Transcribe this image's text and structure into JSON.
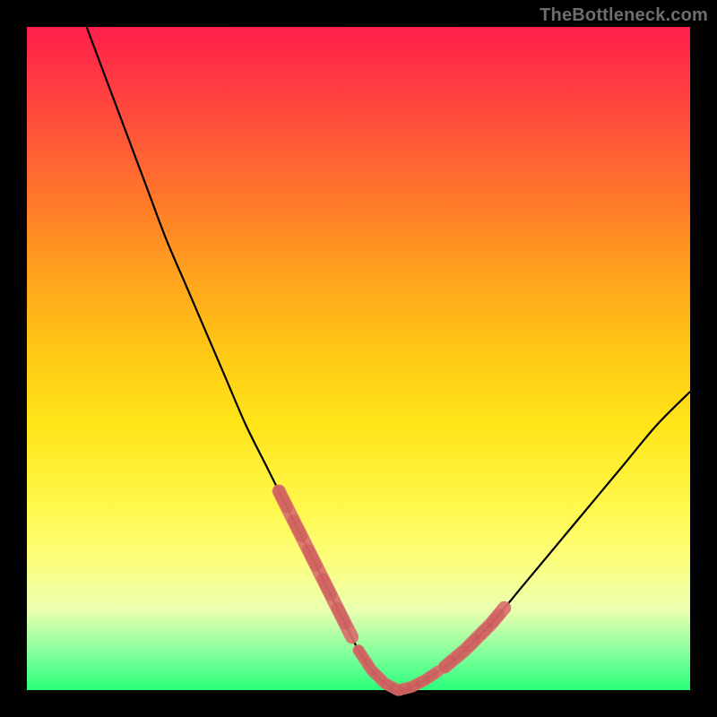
{
  "watermark": "TheBottleneck.com",
  "chart_data": {
    "type": "line",
    "title": "",
    "xlabel": "",
    "ylabel": "",
    "xlim": [
      0,
      100
    ],
    "ylim": [
      0,
      100
    ],
    "grid": false,
    "legend": false,
    "series": [
      {
        "name": "bottleneck-curve",
        "x": [
          9,
          12,
          15,
          18,
          21,
          24,
          27,
          30,
          33,
          36,
          38,
          40,
          42,
          44,
          46,
          48,
          50,
          52,
          54,
          56,
          58,
          60,
          63,
          66,
          70,
          75,
          80,
          85,
          90,
          95,
          100
        ],
        "y": [
          100,
          92,
          84,
          76,
          68,
          61,
          54,
          47,
          40,
          34,
          30,
          26,
          22,
          18,
          14,
          10,
          6,
          3,
          1,
          0,
          0.5,
          1.5,
          3.5,
          6,
          10,
          16,
          22,
          28,
          34,
          40,
          45
        ]
      }
    ],
    "highlight_segments": [
      {
        "name": "left-cluster",
        "x_range": [
          38,
          49
        ]
      },
      {
        "name": "bottom-cluster",
        "x_range": [
          50,
          62
        ]
      },
      {
        "name": "right-cluster",
        "x_range": [
          63,
          72
        ]
      }
    ],
    "colors": {
      "curve": "#000000",
      "highlight_fill": "#da6e6c",
      "highlight_stroke": "#c85a58"
    }
  }
}
